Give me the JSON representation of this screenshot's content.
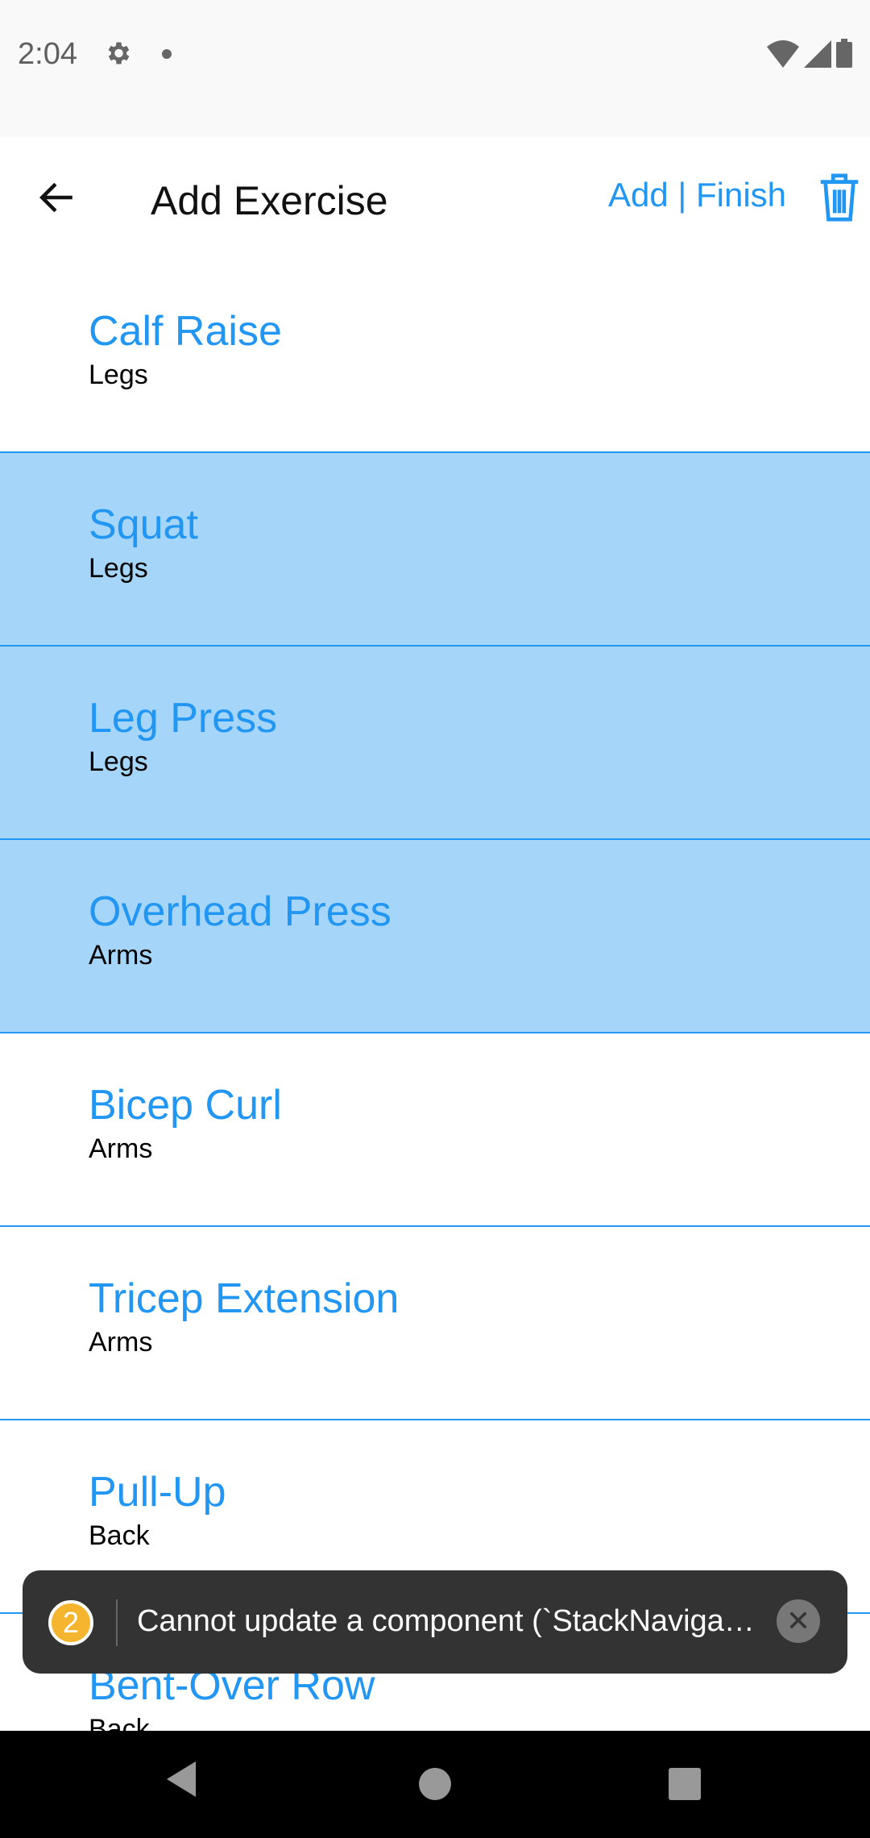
{
  "status_bar": {
    "time": "2:04",
    "icons": [
      "gear-icon",
      "notification-dot-icon",
      "wifi-icon",
      "signal-icon",
      "battery-icon"
    ]
  },
  "header": {
    "title": "Add Exercise",
    "actions": "Add | Finish",
    "back_icon": "arrow-left-icon",
    "delete_icon": "trash-icon"
  },
  "colors": {
    "accent": "#2196f3",
    "selected_row": "#a6d5fa",
    "toast_bg": "#333333",
    "badge": "#f5b52e"
  },
  "exercises": [
    {
      "name": "Calf Raise",
      "category": "Legs",
      "selected": false
    },
    {
      "name": "Squat",
      "category": "Legs",
      "selected": true
    },
    {
      "name": "Leg Press",
      "category": "Legs",
      "selected": true
    },
    {
      "name": "Overhead Press",
      "category": "Arms",
      "selected": true
    },
    {
      "name": "Bicep Curl",
      "category": "Arms",
      "selected": false
    },
    {
      "name": "Tricep Extension",
      "category": "Arms",
      "selected": false
    },
    {
      "name": "Pull-Up",
      "category": "Back",
      "selected": false
    },
    {
      "name": "Bent-Over Row",
      "category": "Back",
      "selected": false
    }
  ],
  "toast": {
    "count": "2",
    "message": "Cannot update a component (`StackNaviga…"
  }
}
